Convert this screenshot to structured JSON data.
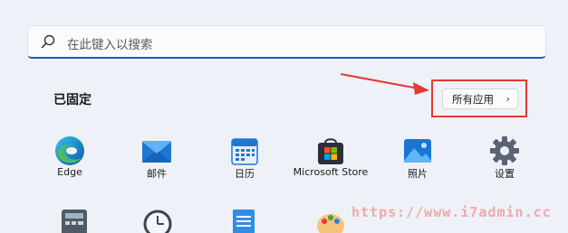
{
  "search": {
    "placeholder": "在此键入以搜索"
  },
  "pinned": {
    "title": "已固定",
    "all_apps_label": "所有应用",
    "all_apps_chevron": "›"
  },
  "apps": [
    {
      "label": "Edge",
      "icon": "edge-icon"
    },
    {
      "label": "邮件",
      "icon": "mail-icon"
    },
    {
      "label": "日历",
      "icon": "calendar-icon"
    },
    {
      "label": "Microsoft Store",
      "icon": "store-icon"
    },
    {
      "label": "照片",
      "icon": "photos-icon"
    },
    {
      "label": "设置",
      "icon": "settings-icon"
    }
  ],
  "watermark": "https://www.i7admin.cc",
  "colors": {
    "accent": "#1a5fb4",
    "highlight": "#e53935",
    "background": "#eef1f7"
  }
}
